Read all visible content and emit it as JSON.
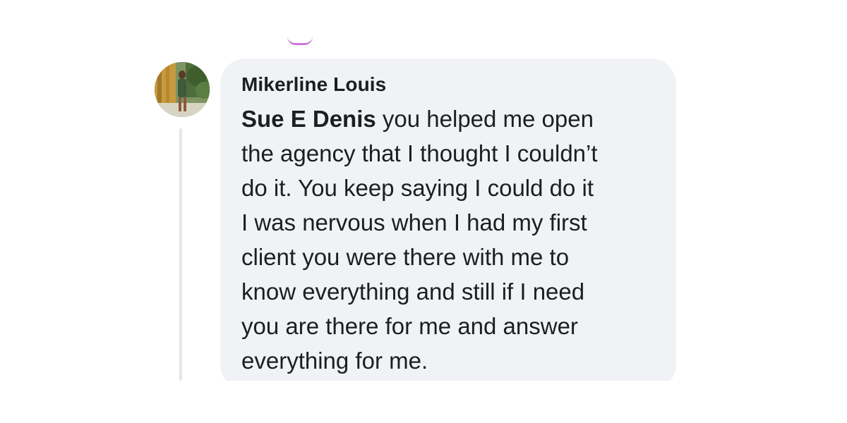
{
  "comment": {
    "author": "Mikerline Louis",
    "mention": "Sue E Denis",
    "lines": [
      " you helped me open",
      "the agency that I thought I couldn’t",
      "do it. You keep saying I could do it",
      "I was nervous when I had my first",
      "client you were there with me to",
      "know everything and still if I need",
      "you are there for me and answer",
      "everything for me."
    ]
  },
  "colors": {
    "bubble_background": "#f0f2f5",
    "text": "#1c1e21",
    "thread_line": "#e4e6eb",
    "accent_fragment": "#c978d6"
  },
  "icons": {
    "avatar": "profile-photo-avatar"
  }
}
